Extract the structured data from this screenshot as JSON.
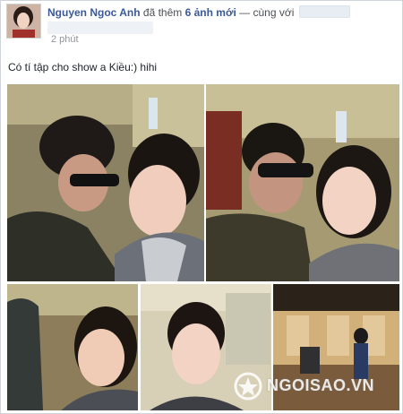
{
  "post": {
    "author": "Nguyen Ngoc Anh",
    "action": "đã thêm",
    "count_text": "6 ảnh mới",
    "with_text": "— cùng với",
    "time": "2 phút",
    "caption": "Có tí tập cho show a Kiều:) hihi"
  },
  "photos": [
    {
      "label": "photo-1"
    },
    {
      "label": "photo-2"
    },
    {
      "label": "photo-3"
    },
    {
      "label": "photo-4"
    },
    {
      "label": "photo-5"
    }
  ],
  "watermark": {
    "text": "NGOISAO.VN"
  },
  "colors": {
    "link": "#3b5998",
    "text": "#1d2129",
    "muted": "#90949c"
  },
  "icons": {
    "avatar": "avatar-photo",
    "watermark_logo": "star-logo-icon"
  }
}
